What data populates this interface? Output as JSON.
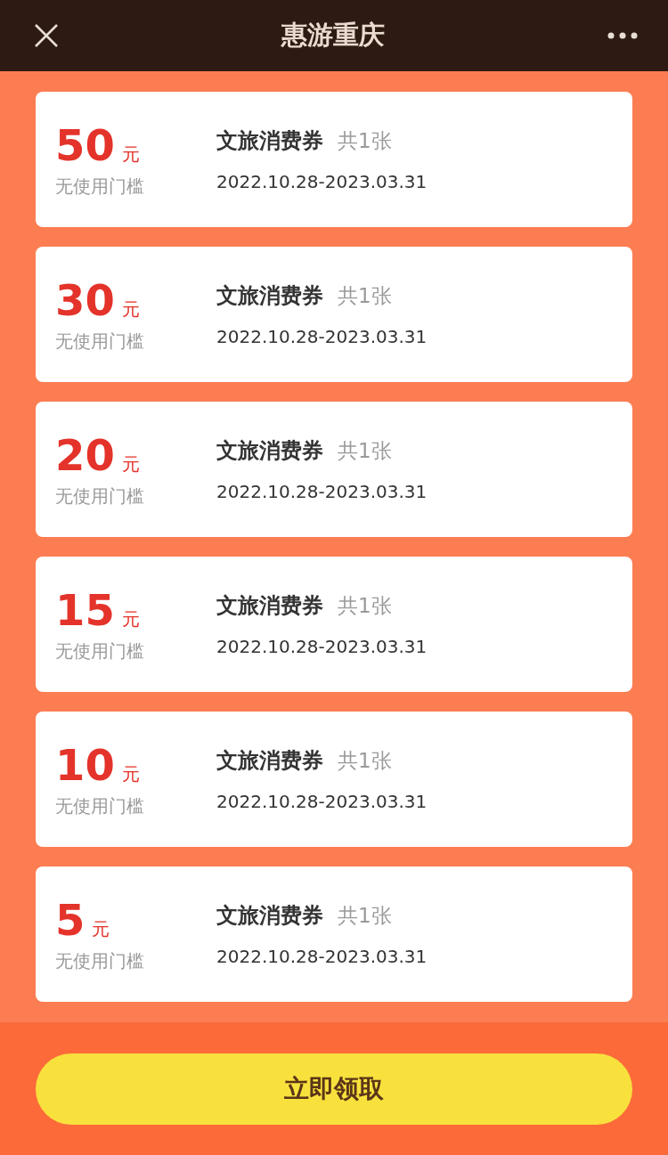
{
  "header": {
    "title": "惠游重庆"
  },
  "coupons": [
    {
      "amount": "50",
      "unit": "元",
      "condition": "无使用门槛",
      "name": "文旅消费券",
      "count": "共1张",
      "validity": "2022.10.28-2023.03.31"
    },
    {
      "amount": "30",
      "unit": "元",
      "condition": "无使用门槛",
      "name": "文旅消费券",
      "count": "共1张",
      "validity": "2022.10.28-2023.03.31"
    },
    {
      "amount": "20",
      "unit": "元",
      "condition": "无使用门槛",
      "name": "文旅消费券",
      "count": "共1张",
      "validity": "2022.10.28-2023.03.31"
    },
    {
      "amount": "15",
      "unit": "元",
      "condition": "无使用门槛",
      "name": "文旅消费券",
      "count": "共1张",
      "validity": "2022.10.28-2023.03.31"
    },
    {
      "amount": "10",
      "unit": "元",
      "condition": "无使用门槛",
      "name": "文旅消费券",
      "count": "共1张",
      "validity": "2022.10.28-2023.03.31"
    },
    {
      "amount": "5",
      "unit": "元",
      "condition": "无使用门槛",
      "name": "文旅消费券",
      "count": "共1张",
      "validity": "2022.10.28-2023.03.31"
    }
  ],
  "claim_button": "立即领取"
}
